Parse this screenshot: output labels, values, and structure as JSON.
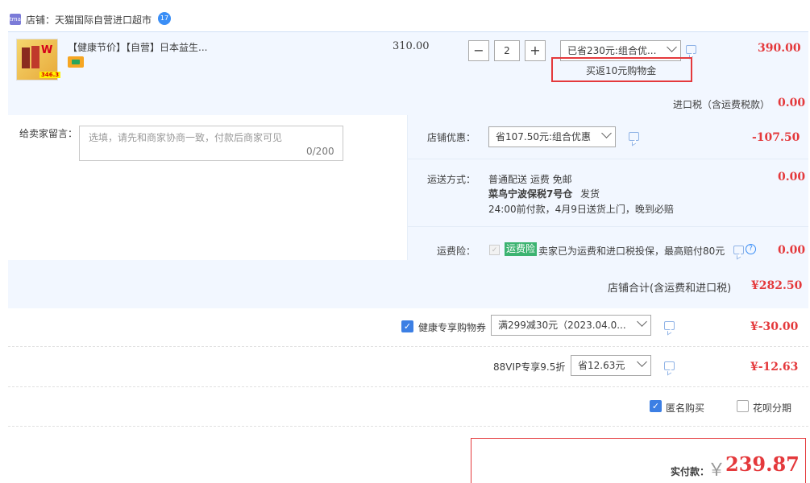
{
  "shop": {
    "badge": "tmall",
    "label": "店铺：天猫国际自营进口超市",
    "chat_badge": "17"
  },
  "item": {
    "title": "【健康节价】【自营】日本益生...",
    "thumb_text": "W",
    "thumb_price": "346.3",
    "unit_price": "310.00",
    "quantity": "2",
    "minus": "−",
    "plus": "+",
    "promo_select": "已省230元:组合优...",
    "cashback": "买返10元购物金",
    "subtotal": "390.00"
  },
  "import_tax": {
    "label": "进口税（含运费税款）",
    "value": "0.00"
  },
  "message": {
    "label": "给卖家留言：",
    "placeholder": "选填，请先和商家协商一致，付款后商家可见",
    "count": "0/200"
  },
  "shop_discount": {
    "label": "店铺优惠：",
    "select": "省107.50元:组合优惠",
    "value": "-107.50"
  },
  "shipping": {
    "label": "运送方式：",
    "line1": "普通配送 运费 免邮",
    "line2": "菜鸟宁波保税7号仓",
    "line2_suffix": "发货",
    "line3": "24:00前付款，4月9日送货上门，晚到必赔",
    "value": "0.00"
  },
  "insurance": {
    "label": "运费险：",
    "tag": "运费险",
    "text": "卖家已为运费和进口税投保，最高赔付80元",
    "help": "?",
    "value": "0.00"
  },
  "shop_total": {
    "label": "店铺合计(含运费和进口税)",
    "value": "¥282.50"
  },
  "coupon": {
    "label": "健康专享购物券",
    "select": "满299减30元（2023.04.0...",
    "value": "¥-30.00"
  },
  "vip": {
    "label": "88VIP专享9.5折",
    "select": "省12.63元",
    "value": "¥-12.63"
  },
  "options": {
    "anonymous": "匿名购买",
    "huabei": "花呗分期"
  },
  "payment": {
    "label": "实付款：",
    "currency": "￥",
    "amount": "239.87"
  },
  "colors": {
    "accent_red": "#e4393c",
    "panel_blue": "#f2f7ff",
    "checkbox_blue": "#3c7fe4",
    "tag_green": "#3cb371"
  }
}
